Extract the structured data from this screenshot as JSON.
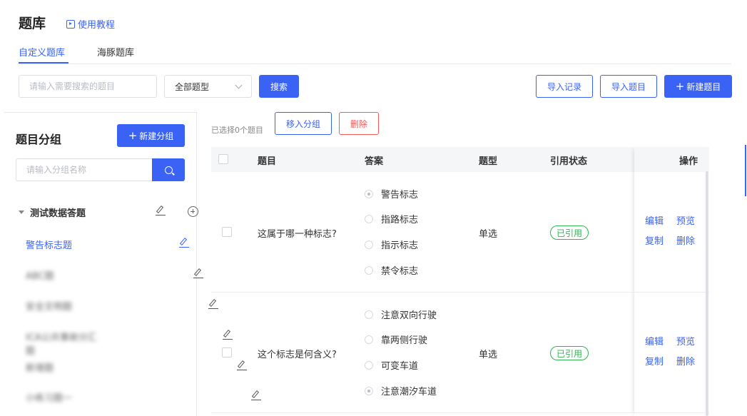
{
  "header": {
    "title": "题库",
    "tutorial_label": "使用教程",
    "tabs": [
      {
        "label": "自定义题库",
        "active": true
      },
      {
        "label": "海豚题库",
        "active": false
      }
    ]
  },
  "toolbar": {
    "search_placeholder": "请输入需要搜索的题目",
    "type_select_value": "全部题型",
    "search_label": "搜索",
    "import_records_label": "导入记录",
    "import_questions_label": "导入题目",
    "new_question_label": "新建题目"
  },
  "sidebar": {
    "title": "题目分组",
    "new_group_label": "新建分组",
    "group_search_placeholder": "请输入分组名称",
    "root_group": "测试数据答题",
    "groups": [
      {
        "label": "警告标志题",
        "active": true
      },
      {
        "label": "ABC题",
        "active": false
      },
      {
        "label": "安全文明题",
        "active": false
      },
      {
        "label": "ICA公共事故分汇题",
        "active": false
      },
      {
        "label": "新增题",
        "active": false
      },
      {
        "label": "小练习题一",
        "active": false
      }
    ]
  },
  "table": {
    "selected_text": "已选择0个题目",
    "move_to_group_label": "移入分组",
    "delete_label": "删除",
    "columns": [
      "题目",
      "答案",
      "题型",
      "引用状态",
      "操作"
    ],
    "rows": [
      {
        "question": "这属于哪一种标志?",
        "options": [
          "警告标志",
          "指路标志",
          "指示标志",
          "禁令标志"
        ],
        "correct_index": 0,
        "type": "单选",
        "status": "已引用",
        "actions": {
          "edit": "编辑",
          "preview": "预览",
          "copy": "复制",
          "delete": "删除"
        }
      },
      {
        "question": "这个标志是何含义?",
        "options": [
          "注意双向行驶",
          "靠两侧行驶",
          "可变车道",
          "注意潮汐车道"
        ],
        "correct_index": 3,
        "type": "单选",
        "status": "已引用",
        "actions": {
          "edit": "编辑",
          "preview": "预览",
          "copy": "复制",
          "delete": "删除"
        }
      }
    ]
  },
  "colors": {
    "primary": "#3a62f5",
    "danger": "#f25a5a",
    "success": "#30b454"
  }
}
